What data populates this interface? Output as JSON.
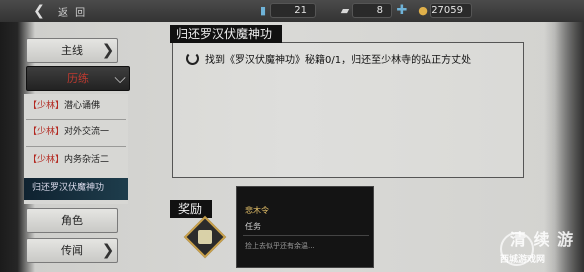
{
  "topbar": {
    "back_icon": "back-arrow-icon",
    "title": "返 回",
    "energy": {
      "icon": "energy-icon",
      "value": "21"
    },
    "silver": {
      "icon": "silver-icon",
      "value": "8"
    },
    "coins": {
      "icon": "coin-icon",
      "value": "27059"
    }
  },
  "tabs": [
    {
      "label": "主线"
    },
    {
      "label": "历练"
    },
    {
      "label": "角色"
    },
    {
      "label": "传闻"
    }
  ],
  "quests": [
    {
      "tag": "【少林】",
      "name": "潜心诵佛"
    },
    {
      "tag": "【少林】",
      "name": "对外交流一"
    },
    {
      "tag": "【少林】",
      "name": "内务杂活二"
    },
    {
      "tag": "",
      "name": "归还罗汉伏魔神功"
    }
  ],
  "detail": {
    "title": "归还罗汉伏魔神功",
    "objective": "找到《罗汉伏魔神功》秘籍0/1，归还至少林寺的弘正方丈处",
    "reward_label": "奖励"
  },
  "tooltip": {
    "name": "悲木令",
    "type": "任务",
    "desc": "捡上去似乎还有余温..."
  },
  "watermark": {
    "title": "清 续 游",
    "subtitle": "西城游戏网"
  },
  "colors": {
    "accent_red": "#c03a30",
    "selected_bg": "#1e3d4c",
    "gold": "#e8c36a"
  }
}
